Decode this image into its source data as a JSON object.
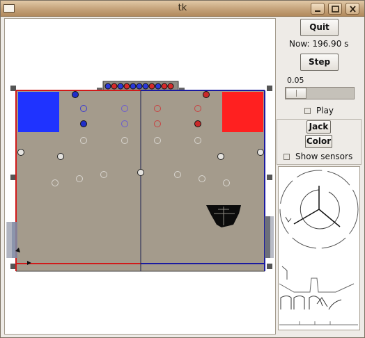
{
  "window": {
    "title": "tk"
  },
  "controls": {
    "quit_label": "Quit",
    "now_text": "Now: 196.90 s",
    "step_label": "Step",
    "scale_value": "0.05",
    "scale_level": 0.05,
    "play_label": "Play",
    "jack_label": "Jack",
    "color_label": "Color",
    "show_sensors_label": "Show sensors"
  },
  "colors": {
    "field": "#a49b8c",
    "red_team": "#ff2020",
    "blue_team": "#1f33ff",
    "wall_left": "#d11a1a",
    "wall_right": "#1a1aa0",
    "robot": "#0c0c0c",
    "sensor_ink": "#333333"
  },
  "icons": {
    "menu": "window-menu-icon",
    "minimize": "minimize-icon",
    "maximize": "maximize-icon",
    "close": "close-icon"
  }
}
